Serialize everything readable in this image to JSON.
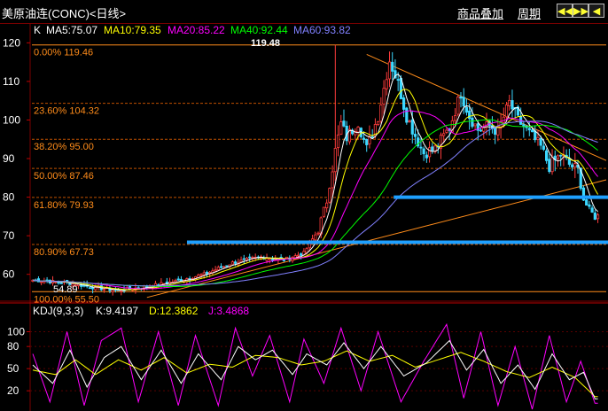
{
  "header": {
    "title": "美原油连(CONC)<日线>",
    "overlay_label": "商品叠加",
    "period_label": "周期",
    "nav_buttons": [
      "◀◀",
      "▶▶",
      "◀",
      "▶"
    ]
  },
  "ma_legend": {
    "k_label": "K",
    "items": [
      {
        "text": "MA5:75.07",
        "color": "#ffffff"
      },
      {
        "text": "MA10:79.35",
        "color": "#ffff00"
      },
      {
        "text": "MA20:85.22",
        "color": "#ff00ff"
      },
      {
        "text": "MA40:92.44",
        "color": "#00ff00"
      },
      {
        "text": "MA60:93.82",
        "color": "#8080ff"
      }
    ]
  },
  "price_axis": {
    "ticks": [
      "120",
      "110",
      "100",
      "90",
      "80",
      "70",
      "60"
    ],
    "color": "#ff6060"
  },
  "fibonacci": {
    "color": "#ff8c1a",
    "levels": [
      {
        "label": "0.00% 119.46",
        "price": 119.46
      },
      {
        "label": "23.60% 104.32",
        "price": 104.32
      },
      {
        "label": "38.20% 95.00",
        "price": 95.0
      },
      {
        "label": "50.00% 87.46",
        "price": 87.46
      },
      {
        "label": "61.80% 79.93",
        "price": 79.93
      },
      {
        "label": "80.90% 67.73",
        "price": 67.73
      },
      {
        "label": "100.00% 55.50",
        "price": 55.5
      }
    ]
  },
  "price_annotations": {
    "high_label": "119.48",
    "low_label": "54.89"
  },
  "support_lines": [
    {
      "price": 80.0,
      "from_fraction": 0.63,
      "color": "#1ea0ff"
    },
    {
      "price": 68.3,
      "from_fraction": 0.27,
      "color": "#1ea0ff"
    }
  ],
  "kdj": {
    "label": "KDJ(9,3,3)",
    "k_text": "K:9.4197",
    "d_text": "D:12.3862",
    "j_text": "J:3.4868",
    "k_color": "#ffffff",
    "d_color": "#ffff00",
    "j_color": "#ff00ff",
    "axis_ticks": [
      "100",
      "80",
      "50",
      "20"
    ]
  },
  "chart_data": {
    "type": "candlestick",
    "title": "美原油连(CONC)<日线>",
    "ylim": [
      53.5,
      121
    ],
    "close_path": [
      [
        0,
        58.5
      ],
      [
        12,
        57.8
      ],
      [
        22,
        56.5
      ],
      [
        30,
        55.8
      ],
      [
        40,
        56.8
      ],
      [
        50,
        58.2
      ],
      [
        60,
        60.0
      ],
      [
        70,
        63.0
      ],
      [
        80,
        64.5
      ],
      [
        88,
        63.8
      ],
      [
        95,
        65.5
      ],
      [
        100,
        71.5
      ],
      [
        103,
        79.0
      ],
      [
        106,
        92.0
      ],
      [
        108,
        99.0
      ],
      [
        110,
        95.5
      ],
      [
        114,
        99.5
      ],
      [
        117,
        92.5
      ],
      [
        121,
        101.0
      ],
      [
        125,
        115.5
      ],
      [
        128,
        109.5
      ],
      [
        131,
        101.0
      ],
      [
        134,
        96.0
      ],
      [
        137,
        91.5
      ],
      [
        141,
        92.5
      ],
      [
        146,
        98.0
      ],
      [
        150,
        107.0
      ],
      [
        153,
        101.0
      ],
      [
        156,
        97.5
      ],
      [
        160,
        98.5
      ],
      [
        163,
        97.0
      ],
      [
        167,
        104.5
      ],
      [
        170,
        100.0
      ],
      [
        174,
        96.5
      ],
      [
        178,
        93.0
      ],
      [
        181,
        88.0
      ],
      [
        185,
        91.0
      ],
      [
        188,
        88.5
      ],
      [
        191,
        87.0
      ],
      [
        193,
        79.5
      ],
      [
        195,
        76.5
      ],
      [
        197,
        75.0
      ]
    ],
    "kdj_k": [
      [
        0,
        55
      ],
      [
        7,
        30
      ],
      [
        13,
        75
      ],
      [
        19,
        25
      ],
      [
        25,
        65
      ],
      [
        31,
        80
      ],
      [
        38,
        35
      ],
      [
        45,
        75
      ],
      [
        52,
        30
      ],
      [
        58,
        70
      ],
      [
        66,
        35
      ],
      [
        72,
        80
      ],
      [
        78,
        62
      ],
      [
        84,
        75
      ],
      [
        91,
        42
      ],
      [
        96,
        70
      ],
      [
        103,
        55
      ],
      [
        109,
        85
      ],
      [
        116,
        50
      ],
      [
        122,
        80
      ],
      [
        130,
        40
      ],
      [
        138,
        58
      ],
      [
        146,
        88
      ],
      [
        152,
        48
      ],
      [
        158,
        76
      ],
      [
        164,
        30
      ],
      [
        170,
        55
      ],
      [
        176,
        22
      ],
      [
        182,
        70
      ],
      [
        188,
        35
      ],
      [
        193,
        45
      ],
      [
        197,
        9
      ]
    ],
    "kdj_d": [
      [
        0,
        48
      ],
      [
        8,
        42
      ],
      [
        15,
        62
      ],
      [
        22,
        42
      ],
      [
        30,
        62
      ],
      [
        38,
        48
      ],
      [
        46,
        65
      ],
      [
        54,
        44
      ],
      [
        62,
        56
      ],
      [
        70,
        52
      ],
      [
        78,
        68
      ],
      [
        86,
        65
      ],
      [
        94,
        55
      ],
      [
        102,
        60
      ],
      [
        110,
        74
      ],
      [
        118,
        60
      ],
      [
        126,
        68
      ],
      [
        134,
        52
      ],
      [
        142,
        62
      ],
      [
        150,
        72
      ],
      [
        158,
        60
      ],
      [
        166,
        46
      ],
      [
        174,
        38
      ],
      [
        182,
        52
      ],
      [
        190,
        38
      ],
      [
        197,
        12
      ]
    ],
    "kdj_j": [
      [
        0,
        70
      ],
      [
        6,
        5
      ],
      [
        12,
        100
      ],
      [
        18,
        0
      ],
      [
        24,
        88
      ],
      [
        31,
        105
      ],
      [
        37,
        5
      ],
      [
        44,
        100
      ],
      [
        51,
        0
      ],
      [
        57,
        95
      ],
      [
        65,
        0
      ],
      [
        71,
        105
      ],
      [
        77,
        40
      ],
      [
        83,
        95
      ],
      [
        90,
        5
      ],
      [
        95,
        90
      ],
      [
        102,
        30
      ],
      [
        108,
        105
      ],
      [
        115,
        20
      ],
      [
        121,
        100
      ],
      [
        129,
        5
      ],
      [
        137,
        60
      ],
      [
        145,
        110
      ],
      [
        151,
        10
      ],
      [
        157,
        100
      ],
      [
        163,
        0
      ],
      [
        169,
        80
      ],
      [
        175,
        -5
      ],
      [
        181,
        95
      ],
      [
        187,
        5
      ],
      [
        192,
        60
      ],
      [
        197,
        3
      ]
    ],
    "kdj_ylim": [
      -5,
      115
    ]
  }
}
